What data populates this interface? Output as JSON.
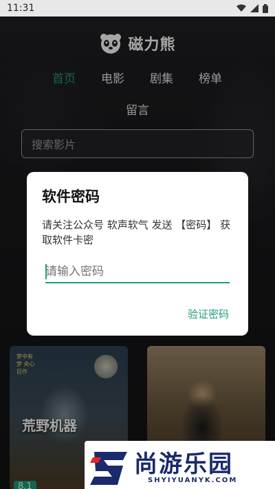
{
  "status_bar": {
    "time": "11:31"
  },
  "header": {
    "app_name": "磁力熊"
  },
  "nav": {
    "tabs": [
      {
        "label": "首页",
        "active": true
      },
      {
        "label": "电影",
        "active": false
      },
      {
        "label": "剧集",
        "active": false
      },
      {
        "label": "榜单",
        "active": false
      },
      {
        "label": "留言",
        "active": false
      }
    ]
  },
  "search": {
    "placeholder": "搜索影片"
  },
  "posters": [
    {
      "title": "荒野机器",
      "tag": "梦中有梦 央心巨作",
      "score": "8.1"
    },
    {
      "title": ""
    }
  ],
  "dialog": {
    "title": "软件密码",
    "message": "请关注公众号 软声软气 发送 【密码】 获取软件卡密",
    "input_placeholder": "请输入密码",
    "verify_label": "验证密码"
  },
  "watermark": {
    "main": "尚游乐园",
    "sub": "SHYIYUANYK.COM"
  },
  "colors": {
    "accent": "#1f9b7a",
    "overlay": "#000000"
  }
}
